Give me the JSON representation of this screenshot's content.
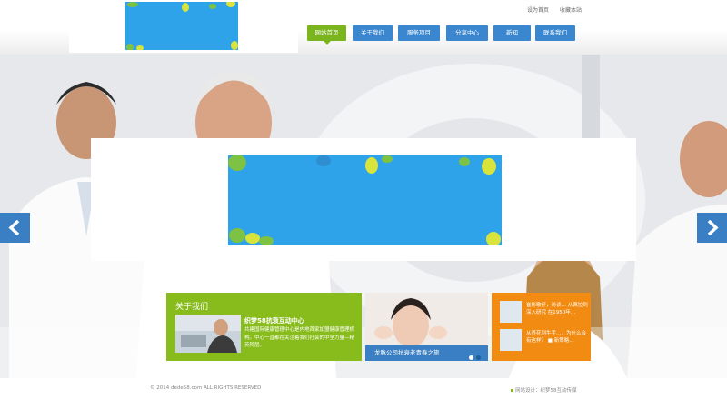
{
  "header": {
    "toplinks": [
      "设为首页",
      "收藏本站"
    ]
  },
  "nav": {
    "items": [
      {
        "label": "网站首页",
        "active": true
      },
      {
        "label": "关于我们",
        "active": false
      },
      {
        "label": "服务项目",
        "active": false
      },
      {
        "label": "分享中心",
        "active": false
      },
      {
        "label": "新知",
        "active": false
      },
      {
        "label": "联系我们",
        "active": false
      }
    ]
  },
  "about": {
    "title": "关于我们",
    "subtitle": "织梦58抗衰互动中心",
    "description": "共建国际健康管理中心是内地首家加盟健康管理机构。中心一直都在关注着我们社会的中坚力量—精英阶层。"
  },
  "feature": {
    "caption": "龙脉公司抗衰老青春之旅"
  },
  "news": {
    "items": [
      {
        "text": "崔彬歌仔，访谈… 从佩拉到深入研究 在1950年…"
      },
      {
        "text": "从养花到牛手…，为什么会有这样？ ■ 新策略…"
      }
    ]
  },
  "footer": {
    "copyright": "© 2014 dede58.com ALL RIGHTS RESERVED",
    "credit": "网站设计：织梦58互动传媒"
  },
  "colors": {
    "nav_blue": "#3a87d0",
    "nav_active_green": "#7ab51d",
    "about_green": "#88bc1d",
    "news_orange": "#f18b12",
    "feature_blue": "#3a7fc3"
  }
}
